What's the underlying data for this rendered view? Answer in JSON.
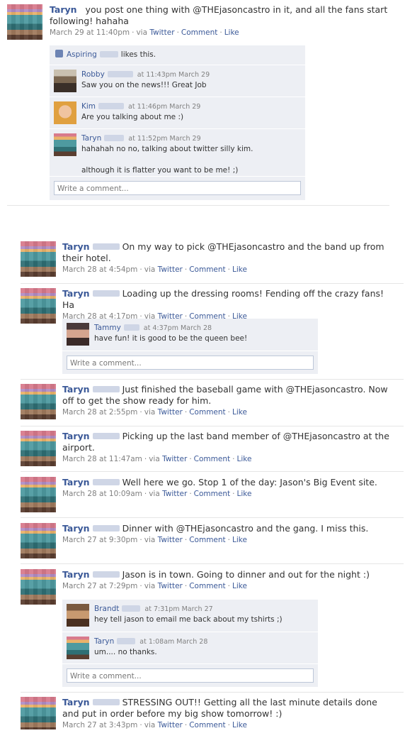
{
  "posts": [
    {
      "author": "Taryn",
      "text": "you post one thing with @THEjasoncastro in it, and all the fans start following! hahaha",
      "time": "March 29 at 11:40pm",
      "via": "via",
      "source": "Twitter",
      "comment_label": "Comment",
      "like_label": "Like",
      "likes": {
        "name": "Aspiring",
        "text": "likes this."
      },
      "comments": [
        {
          "name": "Robby",
          "time": "at 11:43pm March 29",
          "text": "Saw you on the news!!! Great Job"
        },
        {
          "name": "Kim",
          "time": "at 11:46pm March 29",
          "text": "Are you talking about me :)"
        },
        {
          "name": "Taryn",
          "time": "at 11:52pm March 29",
          "text": "hahahah no no, talking about twitter silly kim.",
          "text2": "although it is flatter you want to be me! ;)"
        }
      ],
      "write_placeholder": "Write a comment..."
    },
    {
      "author": "Taryn",
      "text": "On my way to pick @THEjasoncastro and the band up from their hotel.",
      "time": "March 28 at 4:54pm",
      "via": "via",
      "source": "Twitter",
      "comment_label": "Comment",
      "like_label": "Like"
    },
    {
      "author": "Taryn",
      "text": "Loading up the dressing rooms! Fending off the crazy fans! Ha",
      "time": "March 28 at 4:17pm",
      "via": "via",
      "source": "Twitter",
      "comment_label": "Comment",
      "like_label": "Like",
      "comments": [
        {
          "name": "Tammy",
          "time": "at 4:37pm March 28",
          "text": "have fun! it is good to be the queen bee!"
        }
      ],
      "write_placeholder": "Write a comment..."
    },
    {
      "author": "Taryn",
      "text": "Just finished the baseball game with @THEjasoncastro. Now off to get the show ready for him.",
      "time": "March 28 at 2:55pm",
      "via": "via",
      "source": "Twitter",
      "comment_label": "Comment",
      "like_label": "Like"
    },
    {
      "author": "Taryn",
      "text": "Picking up the last band member of @THEjasoncastro at the airport.",
      "time": "March 28 at 11:47am",
      "via": "via",
      "source": "Twitter",
      "comment_label": "Comment",
      "like_label": "Like"
    },
    {
      "author": "Taryn",
      "text": "Well here we go. Stop 1 of the day: Jason's Big Event site.",
      "time": "March 28 at 10:09am",
      "via": "via",
      "source": "Twitter",
      "comment_label": "Comment",
      "like_label": "Like"
    },
    {
      "author": "Taryn",
      "text": "Dinner with @THEjasoncastro and the gang. I miss this.",
      "time": "March 27 at 9:30pm",
      "via": "via",
      "source": "Twitter",
      "comment_label": "Comment",
      "like_label": "Like"
    },
    {
      "author": "Taryn",
      "text": "Jason is in town. Going to dinner and out for the night :)",
      "time": "March 27 at 7:29pm",
      "via": "via",
      "source": "Twitter",
      "comment_label": "Comment",
      "like_label": "Like",
      "comments": [
        {
          "name": "Brandt",
          "time": "at 7:31pm March 27",
          "text": "hey tell jason to email me back about my tshirts ;)"
        },
        {
          "name": "Taryn",
          "time": "at 1:08am March 28",
          "text": "um.... no thanks."
        }
      ],
      "write_placeholder": "Write a comment..."
    },
    {
      "author": "Taryn",
      "text": "STRESSING OUT!! Getting all the last minute details done and put in order before my big show tomorrow! :)",
      "time": "March 27 at 3:43pm",
      "via": "via",
      "source": "Twitter",
      "comment_label": "Comment",
      "like_label": "Like"
    }
  ],
  "colors": {
    "link": "#3b5998",
    "comment_bg": "#edeff4",
    "meta": "#808080"
  }
}
